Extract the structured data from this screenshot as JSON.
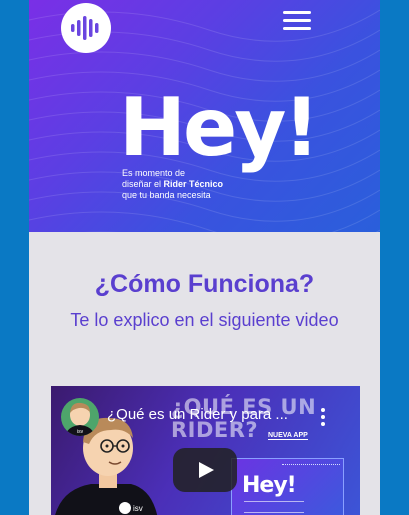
{
  "hero": {
    "heading": "Hey!",
    "tagline_line1": "Es momento de",
    "tagline_line2_prefix": "diseñar el ",
    "tagline_line2_bold": "Rider Técnico",
    "tagline_line3": "que tu banda necesita",
    "logo_icon": "audio-wave-icon",
    "menu_icon": "hamburger-menu-icon"
  },
  "section": {
    "title": "¿Cómo Funciona?",
    "subtitle": "Te lo explico en el siguiente video"
  },
  "video": {
    "title": "¿Qué es un Rider y para ...",
    "thumbnail_heading": "¿QUÉ ES UN RIDER?",
    "thumbnail_tag": "NUEVA APP",
    "preview_heading": "Hey!",
    "avatar_badge": "isv",
    "shirt_badge": "isv",
    "play_icon": "play-icon",
    "more_icon": "more-vertical-icon"
  },
  "colors": {
    "page_bg": "#0a79c4",
    "hero_gradient_start": "#7a2fe6",
    "hero_gradient_end": "#2a5fdb",
    "accent_text": "#5a3fcf",
    "content_bg": "#e4e3e8"
  }
}
